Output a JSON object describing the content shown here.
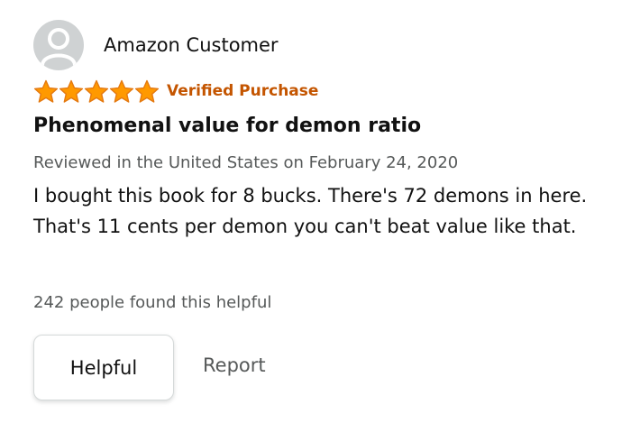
{
  "reviewer": {
    "name": "Amazon Customer",
    "avatar_icon": "user-silhouette-icon"
  },
  "rating": {
    "stars": 5,
    "max_stars": 5,
    "star_color": "#ff9900",
    "verified_label": "Verified Purchase",
    "verified_color": "#c45500"
  },
  "review": {
    "title": "Phenomenal value for demon ratio",
    "date_line": "Reviewed in the United States on February 24, 2020",
    "body": "I bought this book for 8 bucks. There's 72 demons in here. That's 11 cents per demon you can't beat value like that."
  },
  "feedback": {
    "helpful_count_text": "242 people found this helpful",
    "helpful_button_label": "Helpful",
    "report_label": "Report"
  }
}
